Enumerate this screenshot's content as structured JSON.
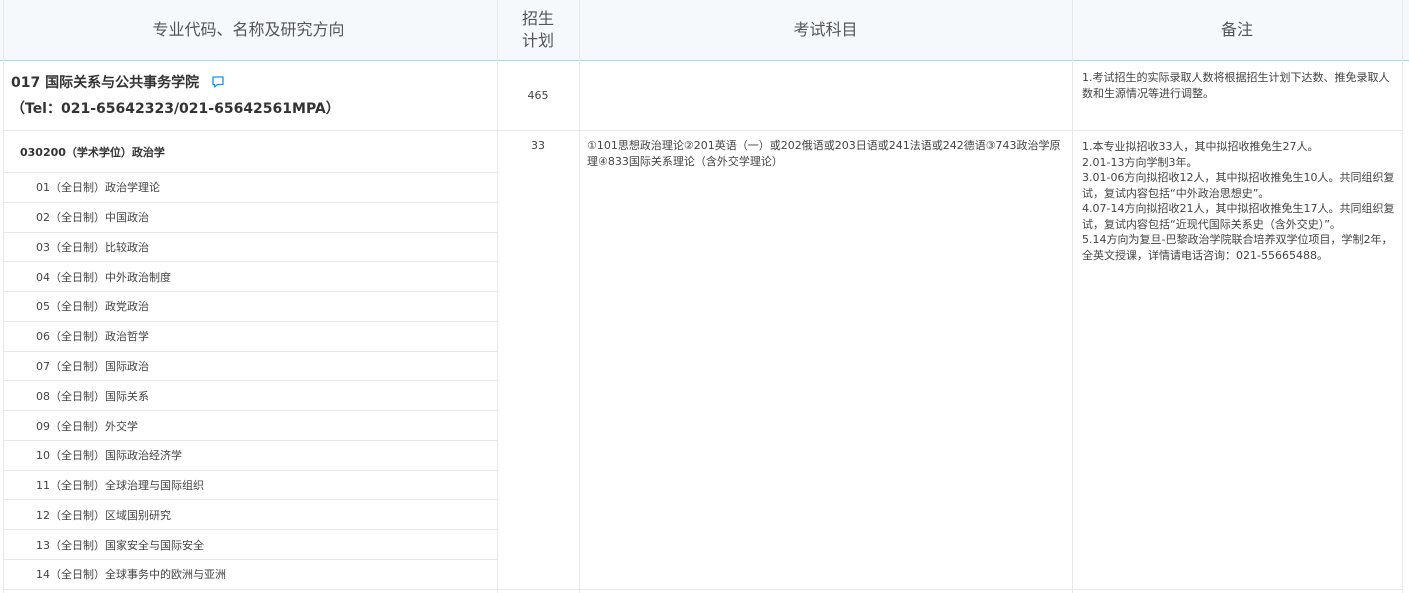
{
  "header": {
    "col_major": "专业代码、名称及研究方向",
    "col_plan": "招生\n计划",
    "col_exam": "考试科目",
    "col_notes": "备注"
  },
  "school": {
    "name": "017 国际关系与公共事务学院",
    "tel": "（Tel：021-65642323/021-65642561MPA）",
    "plan": "465",
    "note": "1.考试招生的实际录取人数将根据招生计划下达数、推免录取人数和生源情况等进行调整。"
  },
  "major": {
    "title": "030200（学术学位）政治学",
    "plan": "33",
    "exam": "①101思想政治理论②201英语（一）或202俄语或203日语或241法语或242德语③743政治学原理④833国际关系理论（含外交学理论）",
    "notes": [
      "1.本专业拟招收33人，其中拟招收推免生27人。",
      "2.01-13方向学制3年。",
      "3.01-06方向拟招收12人，其中拟招收推免生10人。共同组织复试，复试内容包括“中外政治思想史”。",
      "4.07-14方向拟招收21人，其中拟招收推免生17人。共同组织复试，复试内容包括“近现代国际关系史（含外交史）”。",
      "5.14方向为复旦-巴黎政治学院联合培养双学位项目，学制2年，全英文授课，详情请电话咨询：021-55665488。"
    ],
    "directions": [
      "01（全日制）政治学理论",
      "02（全日制）中国政治",
      "03（全日制）比较政治",
      "04（全日制）中外政治制度",
      "05（全日制）政党政治",
      "06（全日制）政治哲学",
      "07（全日制）国际政治",
      "08（全日制）国际关系",
      "09（全日制）外交学",
      "10（全日制）国际政治经济学",
      "11（全日制）全球治理与国际组织",
      "12（全日制）区域国别研究",
      "13（全日制）国家安全与国际安全",
      "14（全日制）全球事务中的欧洲与亚洲"
    ]
  },
  "icons": {
    "comment": "comment-icon"
  },
  "colors": {
    "accent": "#1890ff",
    "header_bg": "#f6f9fc",
    "header_border": "#a9d6f0"
  }
}
